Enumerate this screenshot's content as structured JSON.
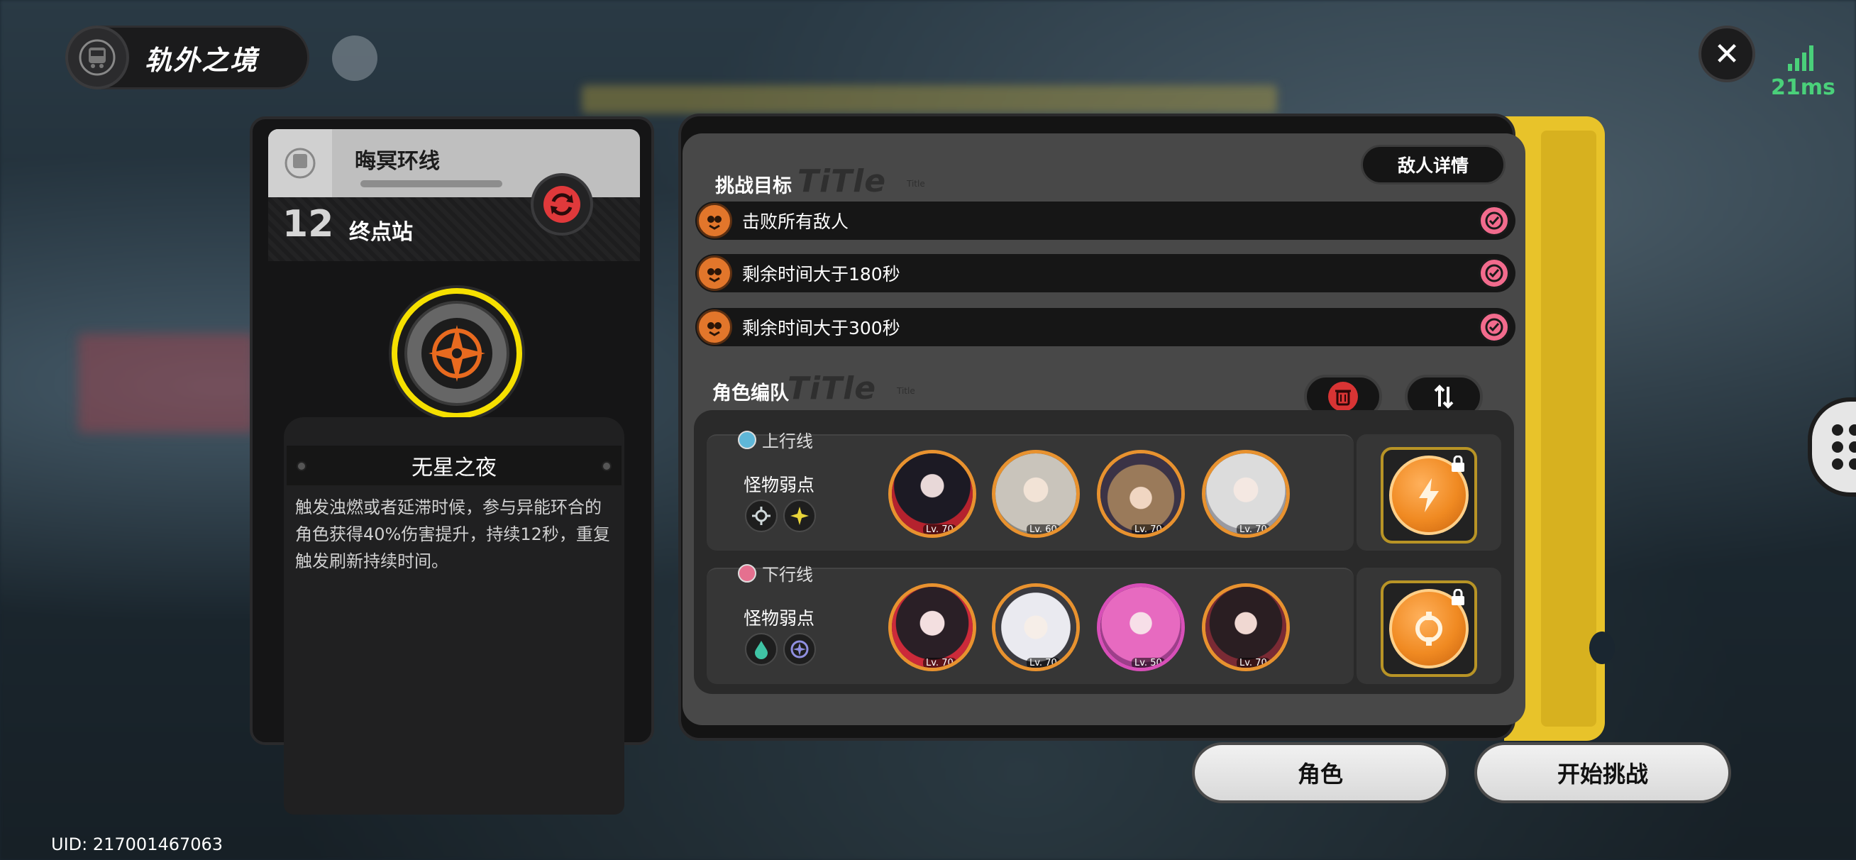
{
  "header": {
    "title": "轨外之境",
    "ping": "21ms"
  },
  "left_card": {
    "line_name": "晦冥环线",
    "station_number": "12",
    "station_name": "终点站",
    "buff_title": "无星之夜",
    "buff_description": "触发浊燃或者延滞时候，参与异能环合的角色获得40%伤害提升，持续12秒，重复触发刷新持续时间。"
  },
  "objectives": {
    "section_label": "挑战目标",
    "ghost_text": "TiTle",
    "ghost_small": "Title",
    "enemy_detail_button": "敌人详情",
    "items": [
      {
        "text": "击败所有敌人",
        "done": true
      },
      {
        "text": "剩余时间大于180秒",
        "done": true
      },
      {
        "text": "剩余时间大于300秒",
        "done": true
      }
    ]
  },
  "team": {
    "section_label": "角色编队",
    "ghost_text": "TiTle",
    "ghost_small": "Title",
    "lanes": [
      {
        "name": "上行线",
        "weakness_label": "怪物弱点",
        "dot_color": "#5fb7d8",
        "characters": [
          {
            "level": "Lv. 70"
          },
          {
            "level": "Lv. 60"
          },
          {
            "level": "Lv. 70"
          },
          {
            "level": "Lv. 70"
          }
        ]
      },
      {
        "name": "下行线",
        "weakness_label": "怪物弱点",
        "dot_color": "#e5708f",
        "characters": [
          {
            "level": "Lv. 70"
          },
          {
            "level": "Lv. 70"
          },
          {
            "level": "Lv. 50"
          },
          {
            "level": "Lv. 70"
          }
        ]
      }
    ]
  },
  "buttons": {
    "character": "角色",
    "start": "开始挑战"
  },
  "footer": {
    "uid": "UID: 217001467063"
  },
  "colors": {
    "accent_orange": "#e8922f",
    "accent_yellow": "#e8c32a",
    "check_pink": "#f26b8d",
    "ping_green": "#4ad07a"
  }
}
